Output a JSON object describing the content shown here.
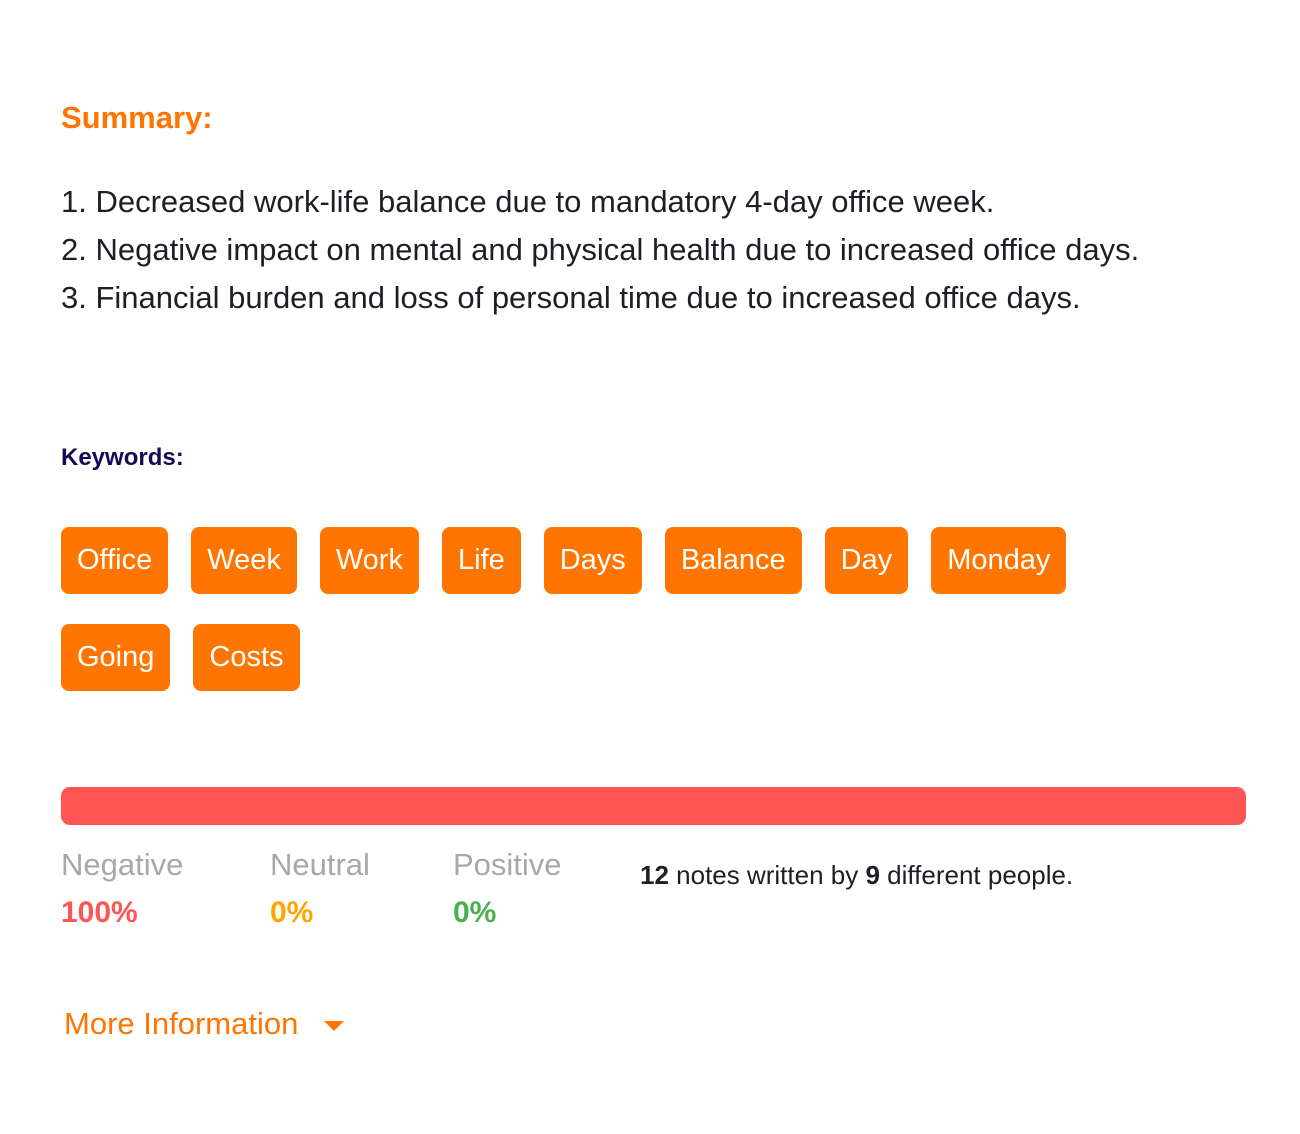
{
  "summary": {
    "title": "Summary:",
    "items": [
      "1. Decreased work-life balance due to mandatory 4-day office week.",
      "2. Negative impact on mental and physical health due to increased office days.",
      "3. Financial burden and loss of personal time due to increased office days."
    ]
  },
  "keywords": {
    "title": "Keywords:",
    "tags": [
      "Office",
      "Week",
      "Work",
      "Life",
      "Days",
      "Balance",
      "Day",
      "Monday",
      "Going",
      "Costs"
    ]
  },
  "sentiment": {
    "segments": [
      {
        "name": "Negative",
        "percent": 100,
        "label": "100%",
        "color": "#ff5555"
      },
      {
        "name": "Neutral",
        "percent": 0,
        "label": "0%",
        "color": "#ffa500"
      },
      {
        "name": "Positive",
        "percent": 0,
        "label": "0%",
        "color": "#4caf50"
      }
    ]
  },
  "notes": {
    "count": "12",
    "middle": " notes written by ",
    "people": "9",
    "suffix": " different people."
  },
  "more_info": {
    "label": "More Information",
    "icon": "caret-down-icon"
  }
}
